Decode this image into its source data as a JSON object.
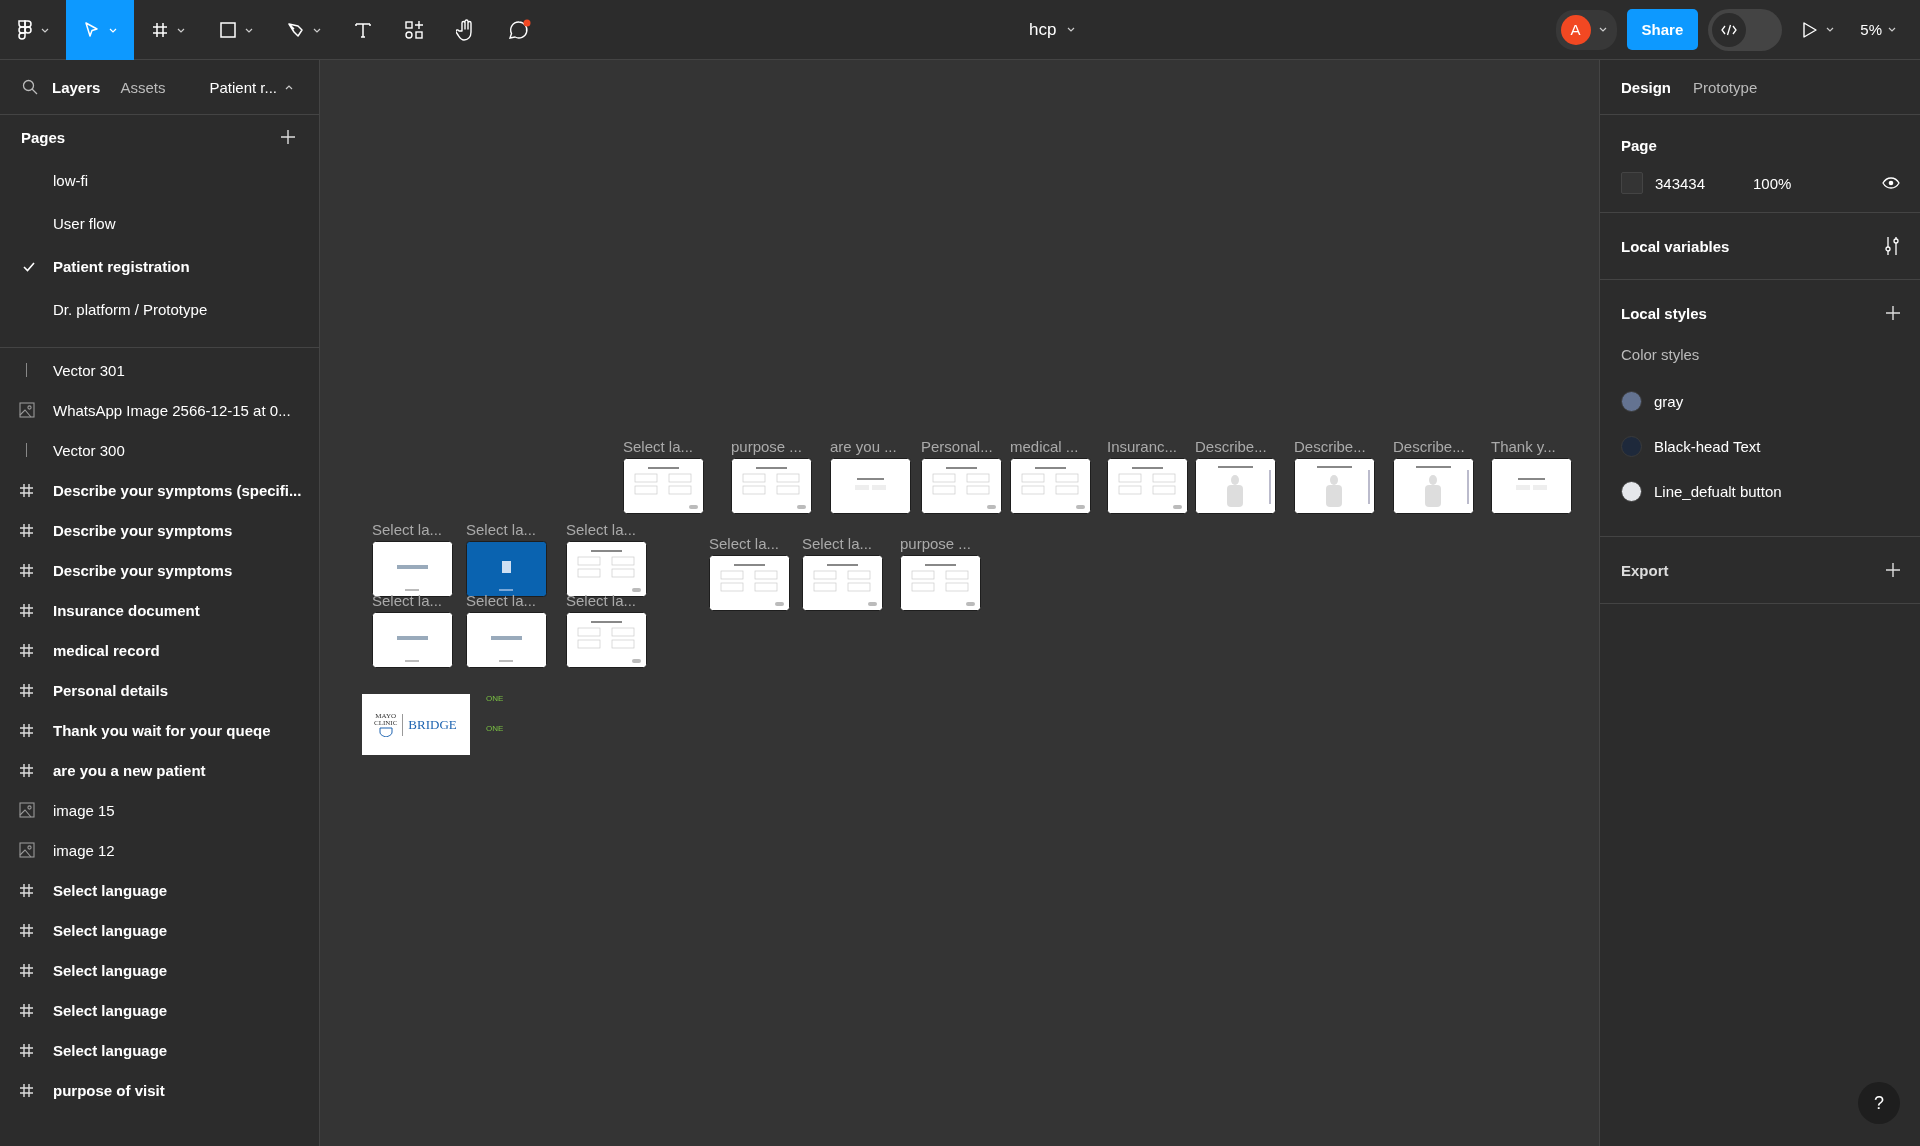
{
  "toolbar": {
    "tools": [
      {
        "kind": "main-menu",
        "selected": false
      },
      {
        "kind": "move",
        "selected": true
      },
      {
        "kind": "frame",
        "selected": false
      },
      {
        "kind": "shape",
        "selected": false
      },
      {
        "kind": "pen",
        "selected": false
      },
      {
        "kind": "text",
        "selected": false
      },
      {
        "kind": "resources",
        "selected": false
      },
      {
        "kind": "hand",
        "selected": false
      },
      {
        "kind": "comment",
        "selected": false
      }
    ],
    "file_title": "hcp",
    "avatar": "A",
    "share": "Share",
    "dev_mode": false,
    "zoom": "5%"
  },
  "left_panel": {
    "tabs": [
      {
        "label": "Layers",
        "selected": true
      },
      {
        "label": "Assets",
        "selected": false
      }
    ],
    "page_menu": "Patient r...",
    "pages_header": "Pages",
    "pages": [
      {
        "name": "low-fi",
        "selected": false
      },
      {
        "name": "User flow",
        "selected": false
      },
      {
        "name": "Patient registration",
        "selected": true
      },
      {
        "name": "Dr. platform / Prototype",
        "selected": false
      }
    ],
    "layers": [
      {
        "kind": "vector",
        "name": "Vector 301"
      },
      {
        "kind": "image",
        "name": "WhatsApp Image 2566-12-15 at 0..."
      },
      {
        "kind": "vector",
        "name": "Vector 300"
      },
      {
        "kind": "frame",
        "name": "Describe your symptoms (specifi..."
      },
      {
        "kind": "frame",
        "name": "Describe your symptoms"
      },
      {
        "kind": "frame",
        "name": "Describe your symptoms"
      },
      {
        "kind": "frame",
        "name": "Insurance document"
      },
      {
        "kind": "frame",
        "name": "medical record"
      },
      {
        "kind": "frame",
        "name": "Personal details"
      },
      {
        "kind": "frame",
        "name": "Thank you wait for your queqe"
      },
      {
        "kind": "frame",
        "name": "are you a new patient"
      },
      {
        "kind": "image",
        "name": "image 15"
      },
      {
        "kind": "image",
        "name": "image 12"
      },
      {
        "kind": "frame",
        "name": "Select language"
      },
      {
        "kind": "frame",
        "name": "Select language"
      },
      {
        "kind": "frame",
        "name": "Select language"
      },
      {
        "kind": "frame",
        "name": "Select language"
      },
      {
        "kind": "frame",
        "name": "Select language"
      },
      {
        "kind": "frame",
        "name": "purpose of visit"
      }
    ]
  },
  "canvas": {
    "frames": [
      {
        "label": "Select la...",
        "kind": "form"
      },
      {
        "label": "purpose ...",
        "kind": "form"
      },
      {
        "label": "are you ...",
        "kind": "dialog"
      },
      {
        "label": "Personal...",
        "kind": "form"
      },
      {
        "label": "medical ...",
        "kind": "form"
      },
      {
        "label": "Insuranc...",
        "kind": "form"
      },
      {
        "label": "Describe...",
        "kind": "body"
      },
      {
        "label": "Describe...",
        "kind": "body"
      },
      {
        "label": "Describe...",
        "kind": "body"
      },
      {
        "label": "Thank y...",
        "kind": "dialog"
      },
      {
        "label": "Select la...",
        "kind": "splash"
      },
      {
        "label": "Select la...",
        "kind": "splash-blue"
      },
      {
        "label": "Select la...",
        "kind": "form"
      },
      {
        "label": "Select la...",
        "kind": "splash"
      },
      {
        "label": "Select la...",
        "kind": "splash"
      },
      {
        "label": "Select la...",
        "kind": "form"
      },
      {
        "label": "Select la...",
        "kind": "form"
      },
      {
        "label": "Select la...",
        "kind": "form"
      },
      {
        "label": "purpose ...",
        "kind": "form"
      }
    ],
    "logo": {
      "line1": "MAYO",
      "line2": "CLINIC",
      "brand": "BRIDGE"
    },
    "side_texts": [
      "ONE",
      "ONE"
    ]
  },
  "right_panel": {
    "tabs": [
      {
        "label": "Design",
        "selected": true
      },
      {
        "label": "Prototype",
        "selected": false
      }
    ],
    "page": {
      "title": "Page",
      "color_value": "343434",
      "opacity": "100%"
    },
    "local_variables": "Local variables",
    "local_styles": "Local styles",
    "color_styles": {
      "label": "Color styles",
      "items": [
        {
          "name": "gray",
          "color": "#647391"
        },
        {
          "name": "Black-head Text",
          "color": "#1e293b"
        },
        {
          "name": "Line_defualt button",
          "color": "#e5e7eb"
        }
      ]
    },
    "export": "Export",
    "help": "?"
  }
}
